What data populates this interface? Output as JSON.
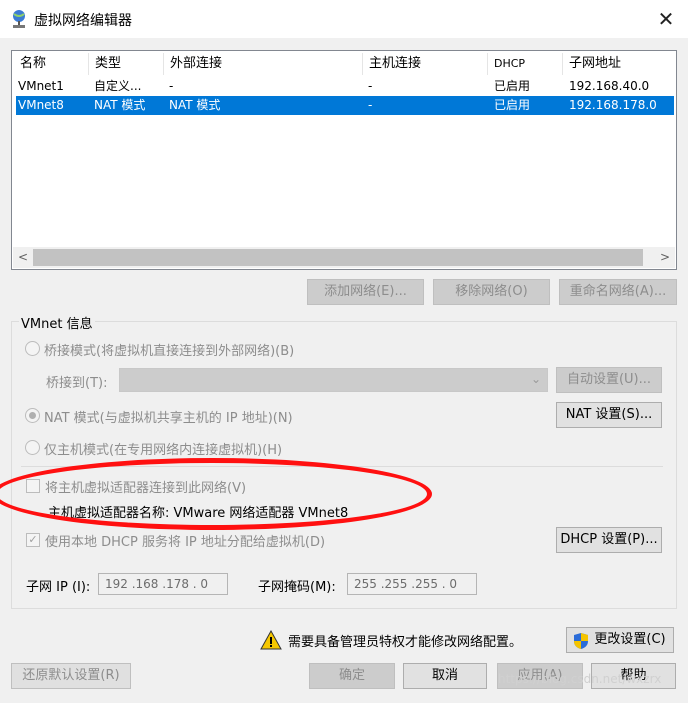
{
  "window": {
    "title": "虚拟网络编辑器"
  },
  "network_list": {
    "headers": [
      "名称",
      "类型",
      "外部连接",
      "主机连接",
      "DHCP",
      "子网地址"
    ],
    "rows": [
      {
        "name": "VMnet1",
        "type": "自定义...",
        "external": "-",
        "host": "-",
        "dhcp": "已启用",
        "subnet": "192.168.40.0",
        "selected": false
      },
      {
        "name": "VMnet8",
        "type": "NAT 模式",
        "external": "NAT 模式",
        "host": "-",
        "dhcp": "已启用",
        "subnet": "192.168.178.0",
        "selected": true
      }
    ]
  },
  "list_buttons": {
    "add": "添加网络(E)...",
    "remove": "移除网络(O)",
    "rename": "重命名网络(A)..."
  },
  "vmnet_info": {
    "label": "VMnet 信息",
    "bridged_radio": "桥接模式(将虚拟机直接连接到外部网络)(B)",
    "bridge_to_label": "桥接到(T):",
    "bridge_to_value": "",
    "auto_settings": "自动设置(U)...",
    "nat_radio": "NAT 模式(与虚拟机共享主机的 IP 地址)(N)",
    "nat_settings": "NAT 设置(S)...",
    "hostonly_radio": "仅主机模式(在专用网络内连接虚拟机)(H)",
    "connect_adapter_check": "将主机虚拟适配器连接到此网络(V)",
    "adapter_name": "主机虚拟适配器名称: VMware 网络适配器 VMnet8",
    "dhcp_check": "使用本地 DHCP 服务将 IP 地址分配给虚拟机(D)",
    "dhcp_settings": "DHCP 设置(P)...",
    "subnet_ip_label": "子网 IP (I):",
    "subnet_ip_value": "192 .168 .178 . 0",
    "subnet_mask_label": "子网掩码(M):",
    "subnet_mask_value": "255 .255 .255 . 0",
    "nat_selected": true,
    "connect_adapter_checked": false,
    "dhcp_checked": true
  },
  "admin_notice": {
    "text": "需要具备管理员特权才能修改网络配置。",
    "change_settings": "更改设置(C)"
  },
  "footer": {
    "restore_defaults": "还原默认设置(R)",
    "ok": "确定",
    "cancel": "取消",
    "apply": "应用(A)",
    "help": "帮助"
  },
  "watermark": "https://blog.csdn.net/wxzrx",
  "colors": {
    "selection": "#0078d7",
    "annotation": "#ff1010",
    "warning": "#f6c700"
  }
}
